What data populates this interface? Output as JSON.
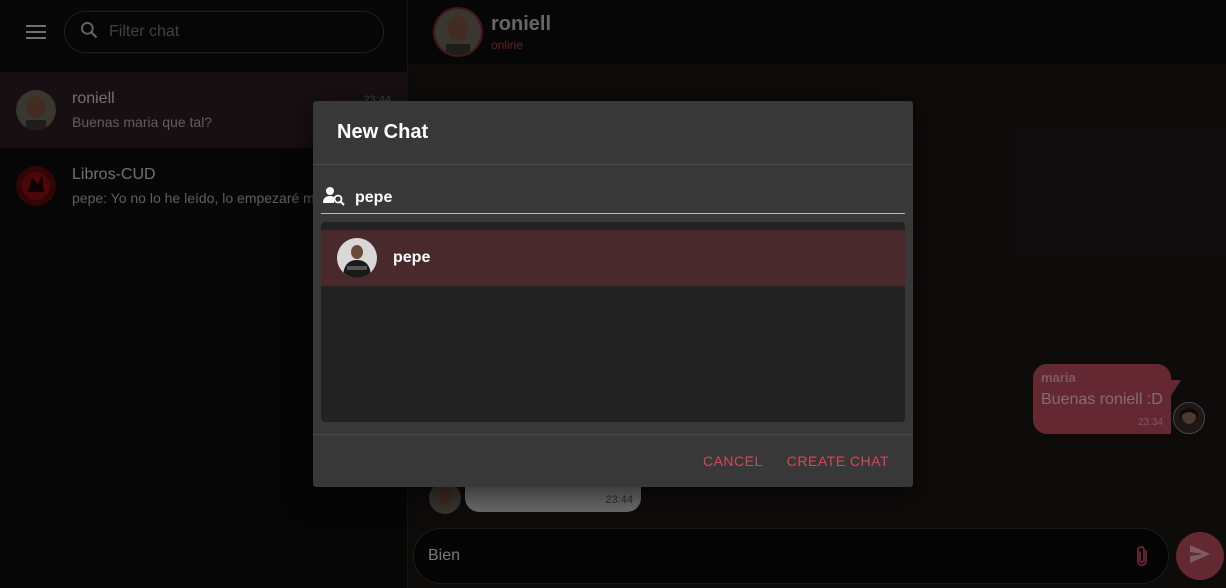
{
  "sidebar": {
    "search_placeholder": "Filter chat",
    "chats": [
      {
        "name": "roniell",
        "preview": "Buenas maria que tal?",
        "time": "23:44"
      },
      {
        "name": "Libros-CUD",
        "preview": "pepe: Yo no lo he leído, lo empezaré mañana"
      }
    ]
  },
  "header": {
    "name": "roniell",
    "status": "online"
  },
  "messages": {
    "outgoing": {
      "author": "maria",
      "text": "Buenas roniell :D",
      "time": "23:34"
    },
    "incoming": {
      "time": "23:44"
    }
  },
  "composer": {
    "value": "Bien"
  },
  "dialog": {
    "title": "New Chat",
    "search_value": "pepe",
    "results": [
      {
        "name": "pepe"
      }
    ],
    "cancel_label": "CANCEL",
    "create_label": "CREATE CHAT"
  },
  "colors": {
    "accent": "#b4495a",
    "accent_text": "#d3475c",
    "selected_bg": "#4a292c"
  },
  "icons": [
    "menu-icon",
    "search-icon",
    "person-search-icon",
    "attach-icon",
    "send-icon"
  ]
}
